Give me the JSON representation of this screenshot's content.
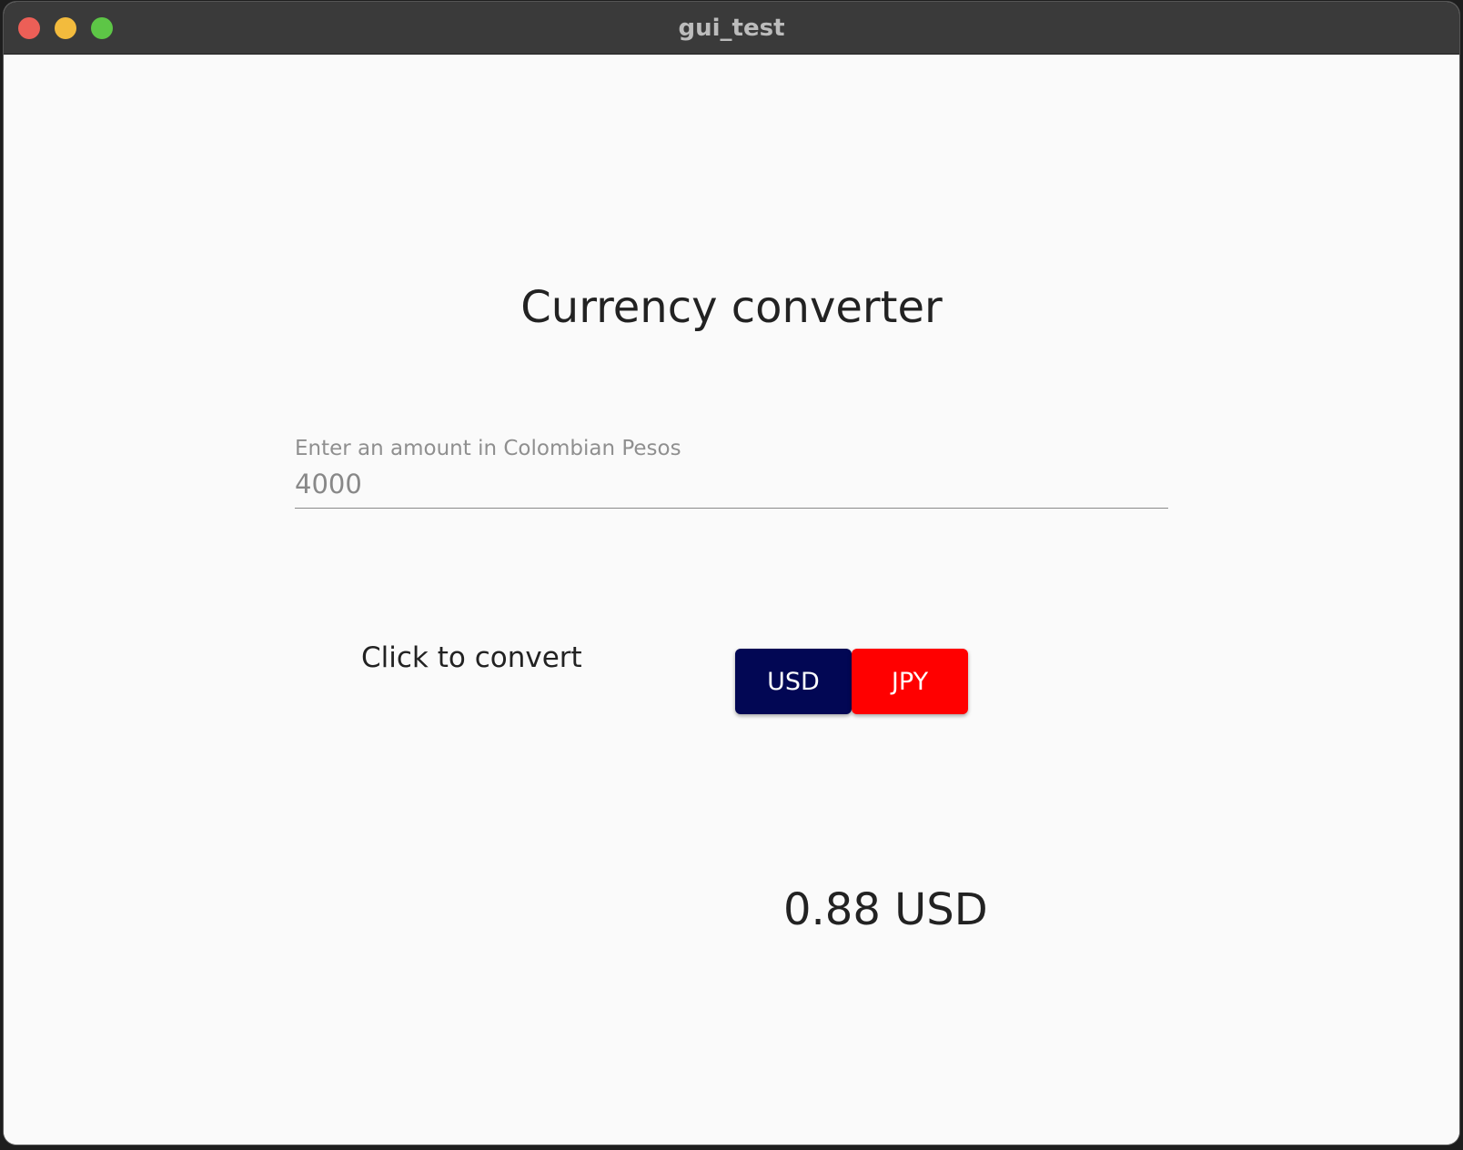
{
  "window": {
    "title": "gui_test",
    "controls": {
      "close_color": "#ec5f57",
      "minimize_color": "#f3bb3d",
      "zoom_color": "#5dc646"
    }
  },
  "main": {
    "heading": "Currency converter",
    "amount_field": {
      "label": "Enter an amount in Colombian Pesos",
      "value": "4000"
    },
    "convert_label": "Click to convert",
    "buttons": [
      {
        "label": "USD",
        "color": "#020754"
      },
      {
        "label": "JPY",
        "color": "#ff0000"
      }
    ],
    "result": "0.88 USD"
  }
}
